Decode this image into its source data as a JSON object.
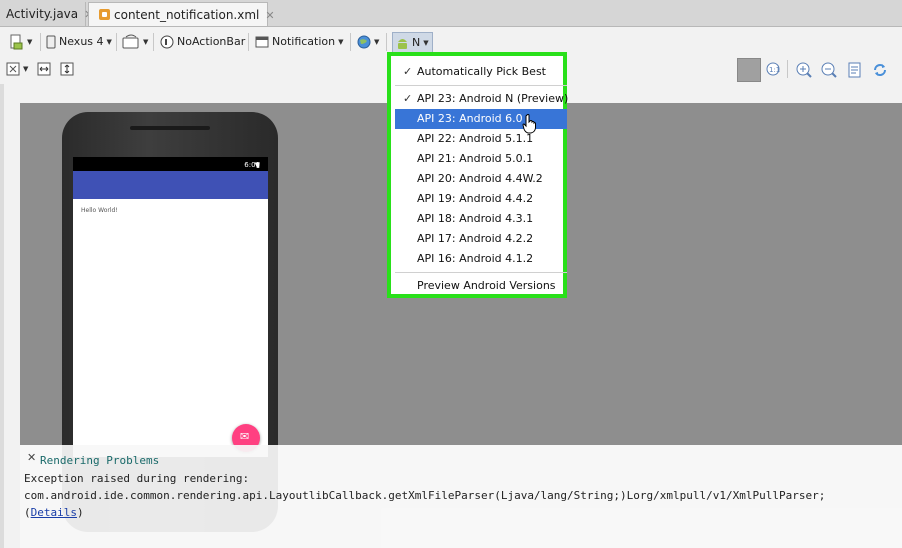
{
  "tabs": [
    {
      "label": "Activity.java",
      "active": false
    },
    {
      "label": "content_notification.xml",
      "active": true
    }
  ],
  "toolbar": {
    "device": "Nexus 4",
    "theme": "NoActionBar",
    "activity": "Notification",
    "api_button": "N"
  },
  "phone": {
    "time": "6:00",
    "hello_text": "Hello World!",
    "appbar_color": "#3f51b5",
    "fab_color": "#ff4081"
  },
  "api_menu": {
    "items": [
      {
        "label": "Automatically Pick Best",
        "checked": true
      },
      {
        "label": "API 23: Android N (Preview)",
        "checked": true
      },
      {
        "label": "API 23: Android 6.0",
        "highlighted": true
      },
      {
        "label": "API 22: Android 5.1.1"
      },
      {
        "label": "API 21: Android 5.0.1"
      },
      {
        "label": "API 20: Android 4.4W.2"
      },
      {
        "label": "API 19: Android 4.4.2"
      },
      {
        "label": "API 18: Android 4.3.1"
      },
      {
        "label": "API 17: Android 4.2.2"
      },
      {
        "label": "API 16: Android 4.1.2"
      },
      {
        "label": "Preview Android Versions"
      }
    ],
    "highlight_color": "#3875d7",
    "border_color": "#29e01a"
  },
  "problems": {
    "title": "Rendering Problems",
    "line1": "Exception raised during rendering:",
    "line2": "com.android.ide.common.rendering.api.LayoutlibCallback.getXmlFileParser(Ljava/lang/String;)Lorg/xmlpull/v1/XmlPullParser;",
    "details_link": "Details"
  }
}
